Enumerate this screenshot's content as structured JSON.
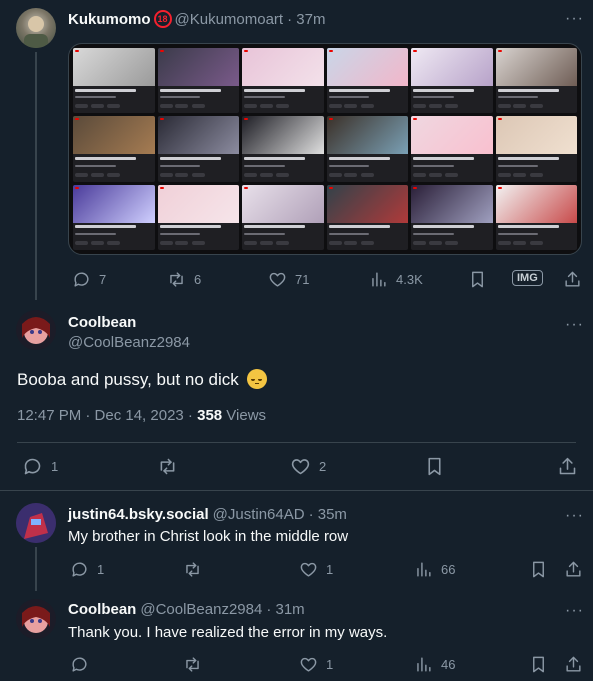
{
  "tweet1": {
    "display_name": "Kukumomo",
    "age_badge": "18",
    "handle": "@Kukumomoart",
    "time": "· 37m",
    "more": "···",
    "actions": {
      "replies": "7",
      "retweets": "6",
      "likes": "71",
      "views": "4.3K",
      "extension": "IMG"
    },
    "media_grid_accent": "#eb0400"
  },
  "tweet2": {
    "display_name": "Coolbean",
    "handle": "@CoolBeanz2984",
    "more": "···",
    "text": "Booba and pussy, but no dick",
    "emoji": "pensive-face",
    "timestamp": "12:47 PM · Dec 14, 2023 · ",
    "views_count": "358",
    "views_label": " Views",
    "actions": {
      "replies": "1",
      "retweets": "",
      "likes": "2"
    }
  },
  "reply1": {
    "display_name": "justin64.bsky.social",
    "handle": "@Justin64AD",
    "time": "· 35m",
    "more": "···",
    "text": "My brother in Christ look in the middle row",
    "actions": {
      "replies": "1",
      "retweets": "",
      "likes": "1",
      "views": "66"
    }
  },
  "reply2": {
    "display_name": "Coolbean",
    "handle": "@CoolBeanz2984",
    "time": "· 31m",
    "more": "···",
    "text": "Thank you. I have realized the error in my ways.",
    "actions": {
      "replies": "",
      "retweets": "",
      "likes": "1",
      "views": "46"
    }
  },
  "colors": {
    "background": "#15202b",
    "text": "#f7f9f9",
    "muted": "#8b98a5",
    "border": "#38444d"
  }
}
